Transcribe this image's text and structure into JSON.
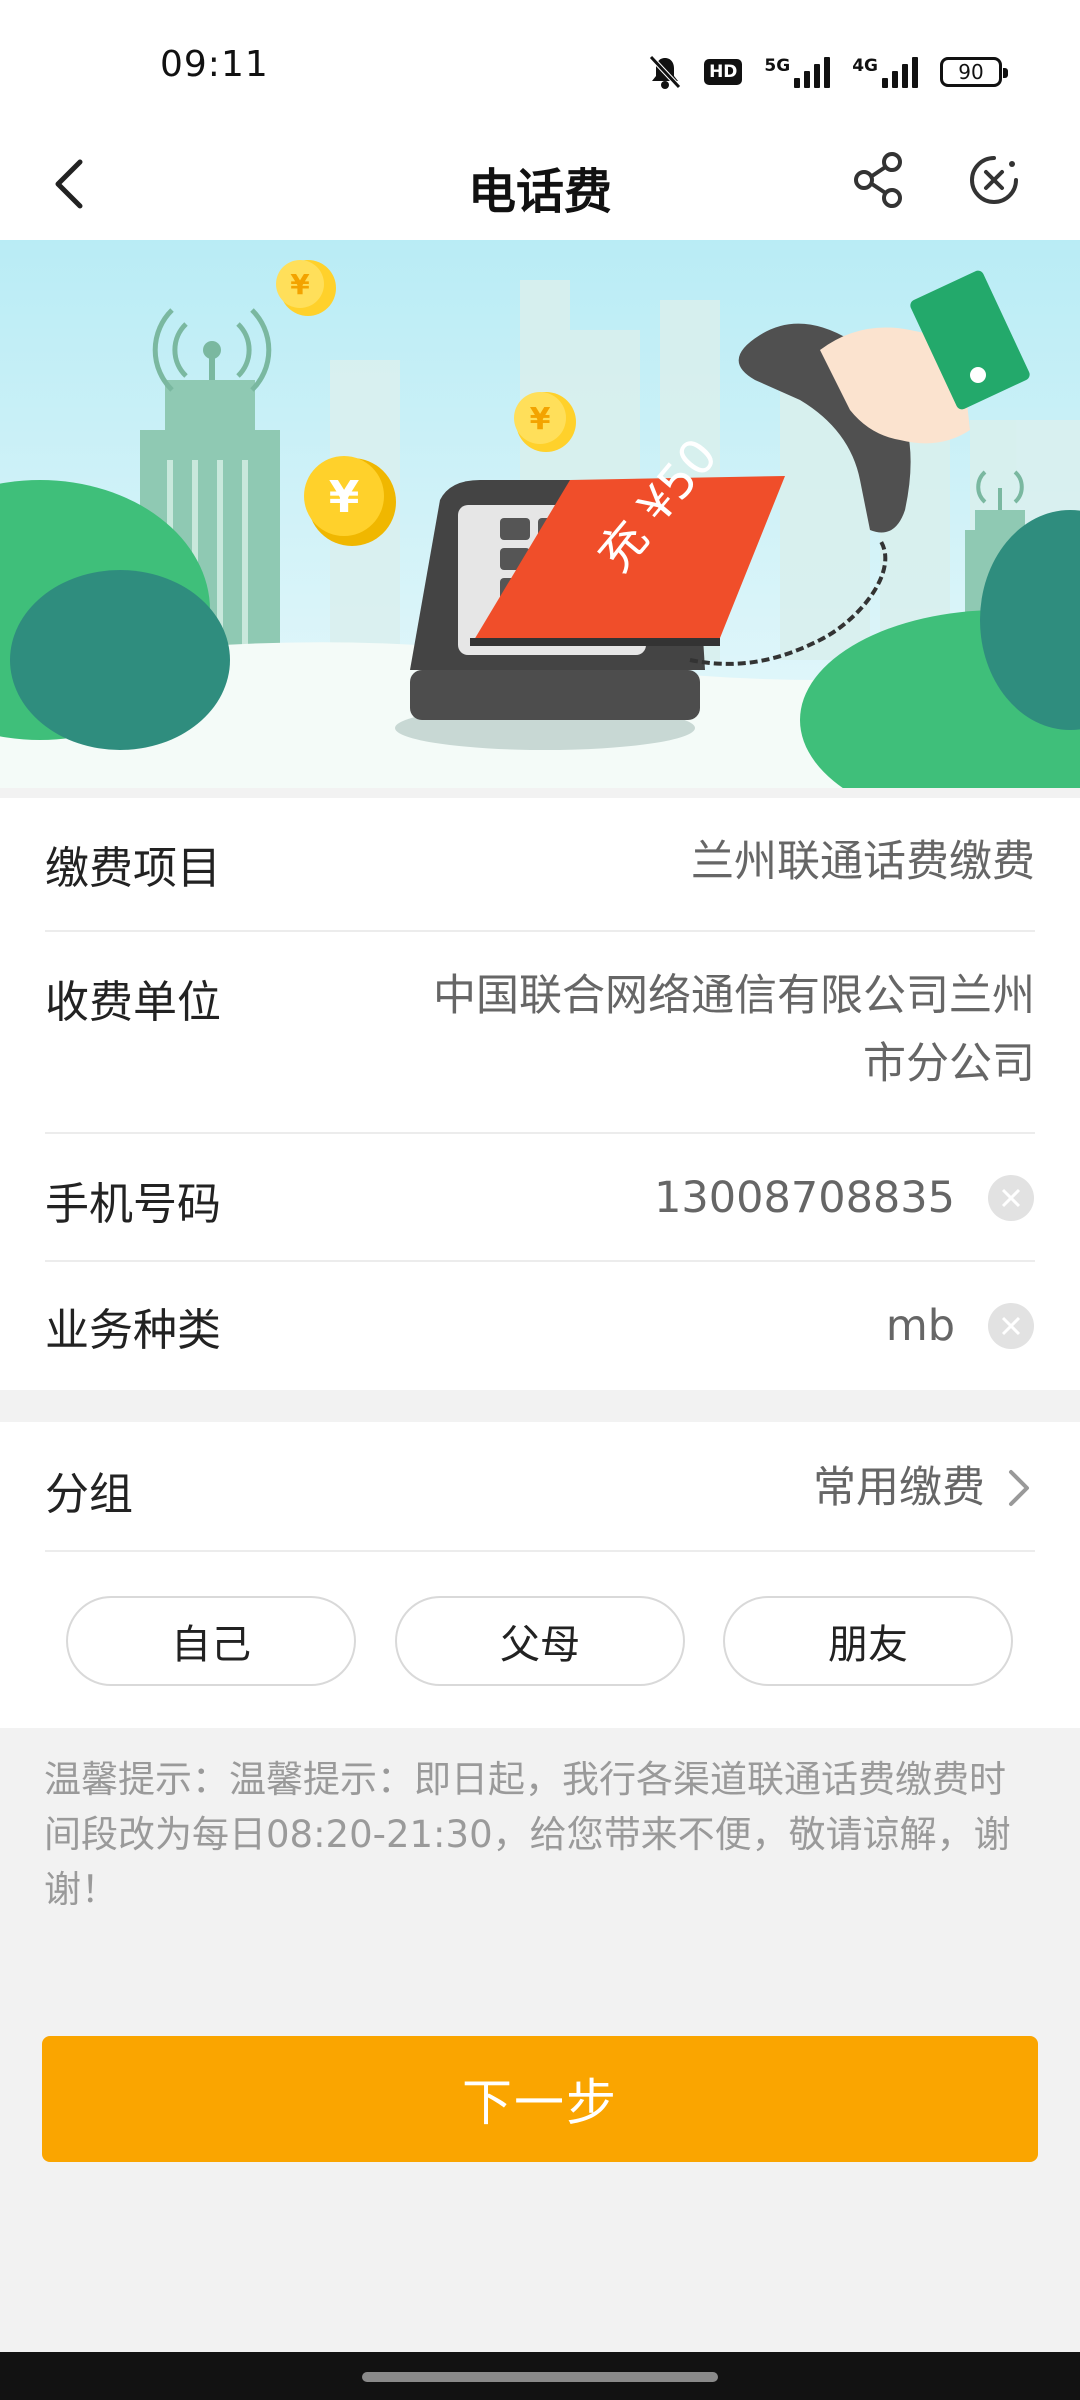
{
  "status_bar": {
    "time": "09:11",
    "battery": "90",
    "signal_1": "5G",
    "signal_2": "4G",
    "hd": "HD"
  },
  "title_bar": {
    "title": "电话费"
  },
  "banner": {
    "recharge_text": "充 ¥50",
    "coin_symbol": "¥"
  },
  "form": {
    "rows": [
      {
        "label": "缴费项目",
        "value": "兰州联通话费缴费"
      },
      {
        "label": "收费单位",
        "value": "中国联合网络通信有限公司兰州市分公司"
      },
      {
        "label": "手机号码",
        "value": "13008708835"
      },
      {
        "label": "业务种类",
        "value": "mb"
      }
    ]
  },
  "group": {
    "label": "分组",
    "value": "常用缴费",
    "chips": [
      "自己",
      "父母",
      "朋友"
    ]
  },
  "notice": "温馨提示：温馨提示：即日起，我行各渠道联通话费缴费时间段改为每日08:20-21:30，给您带来不便，敬请谅解，谢谢！",
  "next_button": "下一步",
  "colors": {
    "accent": "#faa500",
    "banner_green": "#3fbf7a",
    "recharge_red": "#f04e2a"
  }
}
